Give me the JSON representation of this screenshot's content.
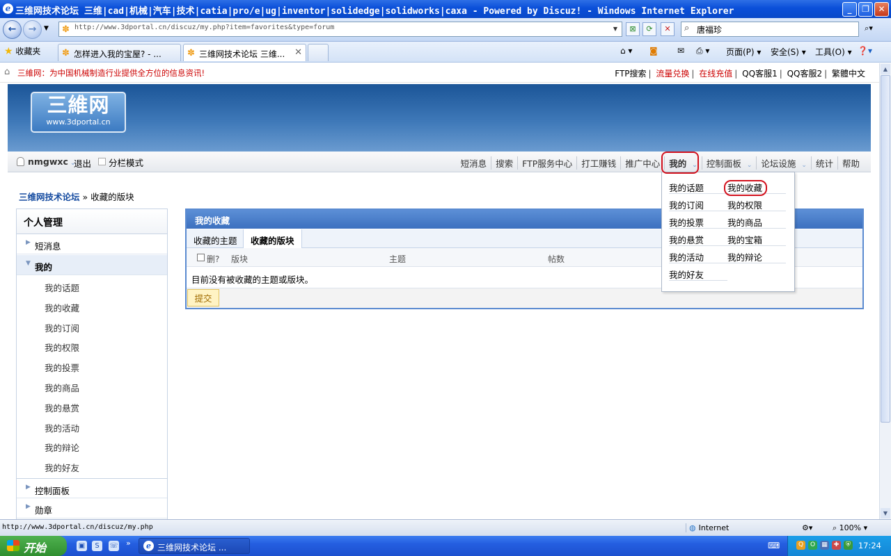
{
  "window": {
    "title": "三维网技术论坛 三维|cad|机械|汽车|技术|catia|pro/e|ug|inventor|solidedge|solidworks|caxa - Powered by Discuz! - Windows Internet Explorer",
    "app_icon": "ie-icon"
  },
  "address_bar": {
    "url": "http://www.3dportal.cn/discuz/my.php?item=favorites&type=forum",
    "search_value": "唐福珍"
  },
  "tabs_bar": {
    "favorites_label": "收藏夹",
    "tabs": [
      {
        "label": "怎样进入我的宝屋? - ..."
      },
      {
        "label": "三维网技术论坛 三维..."
      }
    ],
    "commands": {
      "page": "页面(P)",
      "safety": "安全(S)",
      "tools": "工具(O)"
    }
  },
  "site": {
    "slogan": "三維网：为中国机械制造行业提供全方位的信息资讯!",
    "top_links": [
      "FTP搜索",
      "流量兑换",
      "在线充值",
      "QQ客服1",
      "QQ客服2",
      "繁體中文"
    ],
    "logo_cn": "三維网",
    "logo_en": "www.3dportal.cn",
    "username": "nmgwxc",
    "logout": "退出",
    "split_mode": "分栏模式",
    "nav": [
      "短消息",
      "搜索",
      "FTP服务中心",
      "打工赚钱",
      "推广中心",
      "我的",
      "控制面板",
      "论坛设施",
      "统计",
      "帮助"
    ]
  },
  "breadcrumb": {
    "home": "三维网技术论坛",
    "separator": "»",
    "current": "收藏的版块"
  },
  "sidebar": {
    "title": "个人管理",
    "groups": {
      "messages": "短消息",
      "mine": "我的",
      "control_panel": "控制面板",
      "medals": "勋章"
    },
    "mine_items": [
      "我的话题",
      "我的收藏",
      "我的订阅",
      "我的权限",
      "我的投票",
      "我的商品",
      "我的悬赏",
      "我的活动",
      "我的辩论",
      "我的好友"
    ]
  },
  "favorites": {
    "title": "我的收藏",
    "tab_topics": "收藏的主题",
    "tab_forums": "收藏的版块",
    "col_delete": "删?",
    "col_forum": "版块",
    "col_topic": "主题",
    "col_posts": "帖数",
    "empty_message": "目前没有被收藏的主题或版块。",
    "submit": "提交"
  },
  "dropdown": {
    "items": [
      "我的话题",
      "我的收藏",
      "我的订阅",
      "我的权限",
      "我的投票",
      "我的商品",
      "我的悬赏",
      "我的宝箱",
      "我的活动",
      "我的辩论",
      "我的好友"
    ]
  },
  "status_bar": {
    "url": "http://www.3dportal.cn/discuz/my.php",
    "zone": "Internet",
    "zoom": "100%"
  },
  "taskbar": {
    "start": "开始",
    "task_label": "三维网技术论坛 ...",
    "clock": "17:24"
  },
  "colors": {
    "highlight_circle": "#d2101c",
    "link_blue": "#154ba0",
    "panel_header": "#3c70bf",
    "slogan_red": "#cc0000"
  }
}
